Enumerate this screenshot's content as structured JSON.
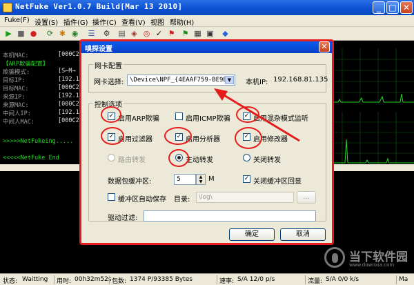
{
  "window": {
    "title": "NetFuke Ver1.0.7 Build[Mar 13 2010]",
    "min_glyph": "_",
    "max_glyph": "□",
    "close_glyph": "✕"
  },
  "menu": [
    "Fuke(F)",
    "设置(S)",
    "插件(G)",
    "操作(C)",
    "查看(V)",
    "视图",
    "帮助(H)"
  ],
  "info_panel": {
    "rows": [
      {
        "label": "本机MAC:",
        "value": "[000C29"
      },
      {
        "label": "【ARP欺骗配置】",
        "value": ""
      },
      {
        "label": "欺骗模式:",
        "value": "[S←M→"
      },
      {
        "label": "目标IP:",
        "value": "[192.16"
      },
      {
        "label": "目标MAC:",
        "value": "[000C29"
      },
      {
        "label": "来源IP:",
        "value": "[192.16"
      },
      {
        "label": "来源MAC:",
        "value": "[000C29"
      },
      {
        "label": "中间人IP:",
        "value": "[192.16"
      },
      {
        "label": "中间人MAC:",
        "value": "[000C29"
      }
    ],
    "fukeing": ">>>>>NetFukeing.....",
    "end": "<<<<<NetFuke End"
  },
  "dialog": {
    "title": "嗅探设置",
    "close_glyph": "✕",
    "nic_group": "网卡配置",
    "nic_label": "网卡选择:",
    "nic_value": "\\Device\\NPF_{4EAAF759-BE9B-4C",
    "local_ip_label": "本机IP:",
    "local_ip": "192.168.81.135",
    "control_group": "控制选项",
    "options": {
      "arp_spoof": "启用ARP欺骗",
      "icmp_spoof": "启用ICMP欺骗",
      "promisc": "启用混杂模式监听",
      "filter": "启用过滤器",
      "analyzer": "启用分析器",
      "modifier": "启用修改器",
      "route_forward": "路由转发",
      "active_forward": "主动转发",
      "close_forward": "关闭转发",
      "buffer_label": "数据包缓冲区:",
      "buffer_value": "5",
      "buffer_unit": "M",
      "close_buffer_echo": "关闭缓冲区回显",
      "buffer_autosave": "缓冲区自动保存",
      "dir_label": "目录:",
      "dir_value": "\\log\\",
      "browse": "...",
      "driver_filter_label": "驱动过滤:",
      "driver_filter_value": ""
    },
    "ok": "确定",
    "cancel": "取消"
  },
  "status": {
    "state_label": "状态:",
    "state": "Waitting",
    "time_label": "用时:",
    "time": "00h32m52s",
    "packets_label": "包数:",
    "packets": "1374 P/93385 Bytes",
    "rate_label": "速率:",
    "rate": "S/A 12/0 p/s",
    "flow_label": "流量:",
    "flow": "S/A 0/0 k/s",
    "tail": "Ma"
  },
  "watermark": {
    "text": "当下软件园",
    "url": "www.downxia.com"
  },
  "colors": {
    "accent_red": "#e61c1c",
    "terminal_green": "#22d822",
    "title_blue": "#0a4fd1"
  }
}
